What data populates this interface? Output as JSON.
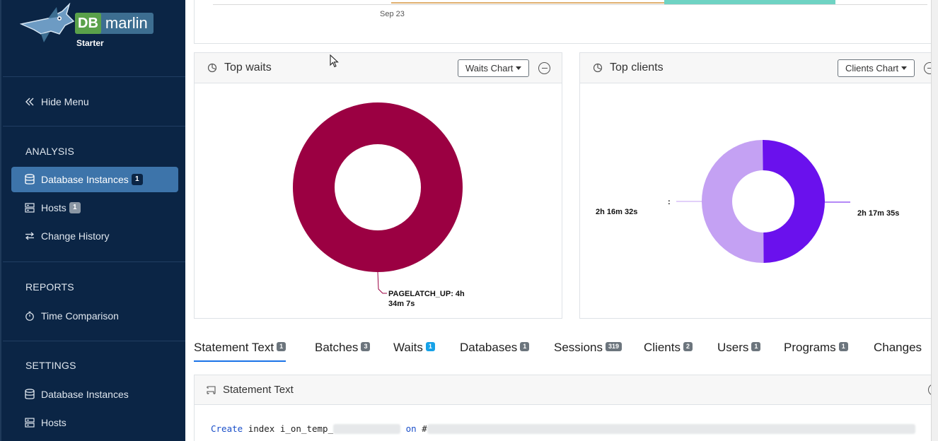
{
  "brand": {
    "db": "DB",
    "name": "marlin",
    "edition": "Starter"
  },
  "sidebar": {
    "hide_menu": "Hide Menu",
    "analysis_title": "ANALYSIS",
    "analysis_items": [
      {
        "label": "Database Instances",
        "badge": "1"
      },
      {
        "label": "Hosts",
        "badge": "1"
      },
      {
        "label": "Change History"
      }
    ],
    "reports_title": "REPORTS",
    "reports_items": [
      {
        "label": "Time Comparison"
      }
    ],
    "settings_title": "SETTINGS",
    "settings_items": [
      {
        "label": "Database Instances"
      },
      {
        "label": "Hosts"
      }
    ]
  },
  "timeline": {
    "tick": "Sep 23"
  },
  "waits_panel": {
    "title": "Top waits",
    "dropdown": "Waits Chart"
  },
  "clients_panel": {
    "title": "Top clients",
    "dropdown": "Clients Chart"
  },
  "chart_data": [
    {
      "type": "pie",
      "title": "Top waits",
      "slices": [
        {
          "label": "PAGELATCH_UP",
          "value_text": "4h 34m 7s",
          "color": "#9b0042"
        }
      ],
      "labels": {
        "line1": "PAGELATCH_UP: 4h",
        "line2": "34m 7s"
      }
    },
    {
      "type": "pie",
      "title": "Top clients",
      "slices": [
        {
          "value_text": "2h 16m 32s",
          "color": "#c4a1f3"
        },
        {
          "value_text": "2h 17m 35s",
          "color": "#6a11ed"
        }
      ],
      "labels": {
        "left_name": ":",
        "left_value": "2h 16m 32s",
        "right_value": "2h 17m 35s"
      }
    }
  ],
  "tabs": [
    {
      "label": "Statement Text",
      "badge": "1",
      "active": true
    },
    {
      "label": "Batches",
      "badge": "3"
    },
    {
      "label": "Waits",
      "badge": "1"
    },
    {
      "label": "Databases",
      "badge": "1"
    },
    {
      "label": "Sessions",
      "badge": "319"
    },
    {
      "label": "Clients",
      "badge": "2"
    },
    {
      "label": "Users",
      "badge": "1"
    },
    {
      "label": "Programs",
      "badge": "1"
    },
    {
      "label": "Changes",
      "badge": ""
    }
  ],
  "statement": {
    "title": "Statement Text",
    "code_kw1": "Create",
    "code_text1": "index i_on_temp_",
    "code_kw2": "on",
    "code_text2": "#"
  },
  "colors": {
    "sidebar_bg": "#0b2545",
    "active_item": "#3d74aa",
    "accent_tab": "#1a73e8"
  }
}
